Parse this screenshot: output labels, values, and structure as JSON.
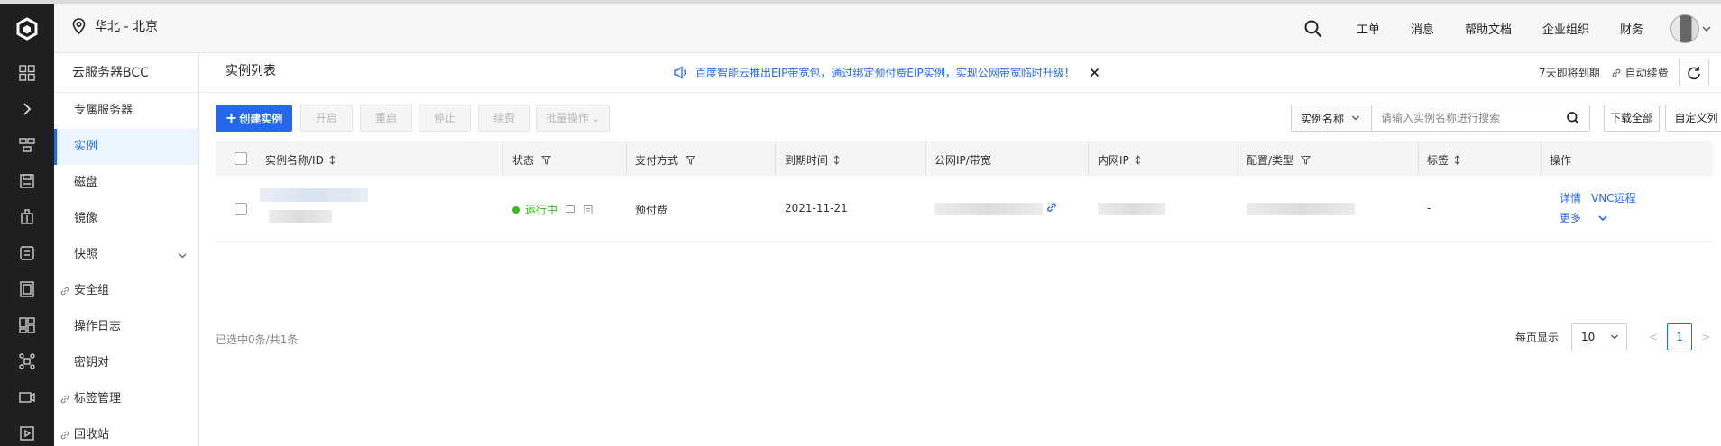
{
  "topbar": {
    "region": "华北 - 北京",
    "links": [
      "工单",
      "消息",
      "帮助文档",
      "企业组织",
      "财务"
    ]
  },
  "sidebar": {
    "title": "云服务器BCC",
    "items": [
      {
        "label": "专属服务器",
        "active": false
      },
      {
        "label": "实例",
        "active": true
      },
      {
        "label": "磁盘",
        "active": false
      },
      {
        "label": "镜像",
        "active": false
      },
      {
        "label": "快照",
        "active": false,
        "expandable": true
      },
      {
        "label": "安全组",
        "active": false,
        "link_icon": true
      },
      {
        "label": "操作日志",
        "active": false
      },
      {
        "label": "密钥对",
        "active": false
      },
      {
        "label": "标签管理",
        "active": false,
        "link_icon": true
      },
      {
        "label": "回收站",
        "active": false,
        "link_icon": true
      }
    ]
  },
  "header": {
    "title": "实例列表",
    "notice": "百度智能云推出EIP带宽包，通过绑定预付费EIP实例，实现公网带宽临时升级！",
    "expiring": "7天即将到期",
    "auto_renew": "自动续费"
  },
  "toolbar": {
    "create": "创建实例",
    "start": "开启",
    "restart": "重启",
    "stop": "停止",
    "renew": "续费",
    "batch": "批量操作",
    "search_field": "实例名称",
    "search_placeholder": "请输入实例名称进行搜索",
    "download_all": "下载全部",
    "custom_columns": "自定义列"
  },
  "table": {
    "columns": [
      "实例名称/ID",
      "状态",
      "支付方式",
      "到期时间",
      "公网IP/带宽",
      "内网IP",
      "配置/类型",
      "标签",
      "操作"
    ],
    "rows": [
      {
        "status": "运行中",
        "payment": "预付费",
        "expire": "2021-11-21",
        "tag": "-",
        "actions": [
          "详情",
          "VNC远程",
          "更多"
        ]
      }
    ]
  },
  "footer": {
    "selected": "已选中0条/共1条",
    "page_size_label": "每页显示",
    "page_size": "10",
    "prev": "<",
    "current_page": "1",
    "next": ">"
  },
  "colors": {
    "accent": "#2468f2",
    "running": "#30bf13",
    "nav_dark": "#1f1f1f"
  }
}
